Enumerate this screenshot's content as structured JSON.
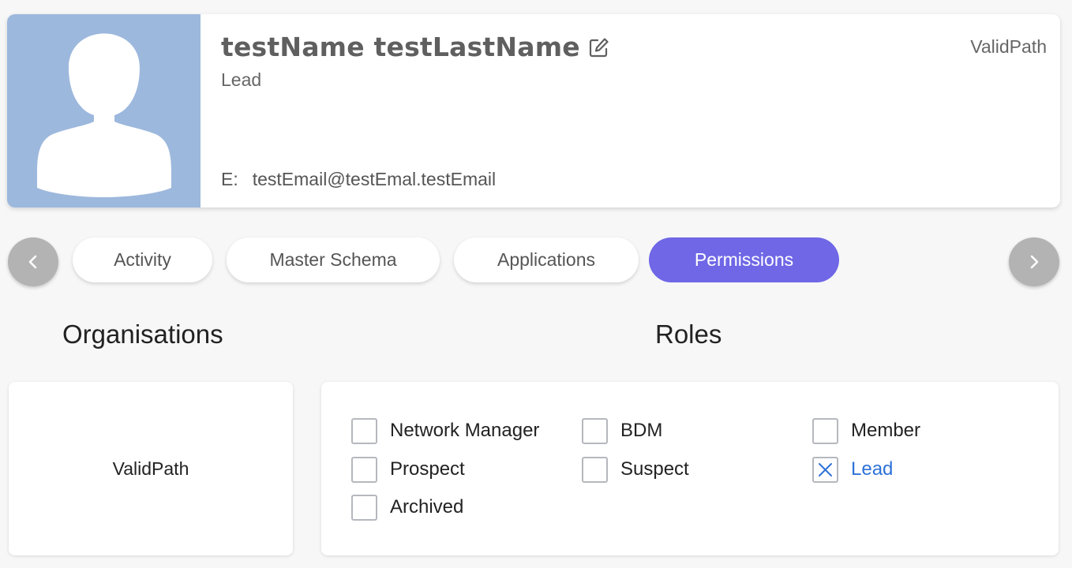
{
  "profile": {
    "name": "testName testLastName",
    "role": "Lead",
    "organisation": "ValidPath",
    "email_prefix": "E:",
    "email": "testEmail@testEmal.testEmail"
  },
  "tabs": [
    {
      "label": "Activity",
      "active": false
    },
    {
      "label": "Master Schema",
      "active": false
    },
    {
      "label": "Applications",
      "active": false
    },
    {
      "label": "Permissions",
      "active": true
    }
  ],
  "organisations": {
    "heading": "Organisations",
    "items": [
      "ValidPath"
    ]
  },
  "roles": {
    "heading": "Roles",
    "items": [
      {
        "label": "Network Manager",
        "checked": false
      },
      {
        "label": "BDM",
        "checked": false
      },
      {
        "label": "Member",
        "checked": false
      },
      {
        "label": "Prospect",
        "checked": false
      },
      {
        "label": "Suspect",
        "checked": false
      },
      {
        "label": "Lead",
        "checked": true
      },
      {
        "label": "Archived",
        "checked": false
      }
    ]
  },
  "icons": {
    "edit": "edit-icon",
    "prev": "chevron-left-icon",
    "next": "chevron-right-icon",
    "avatar": "user-silhouette-icon",
    "check": "x-mark-icon"
  },
  "colors": {
    "accent": "#6f67e6",
    "avatar_bg": "#9db8dd",
    "checked_label": "#2e72d8",
    "nav_arrow": "#b3b3b3"
  }
}
